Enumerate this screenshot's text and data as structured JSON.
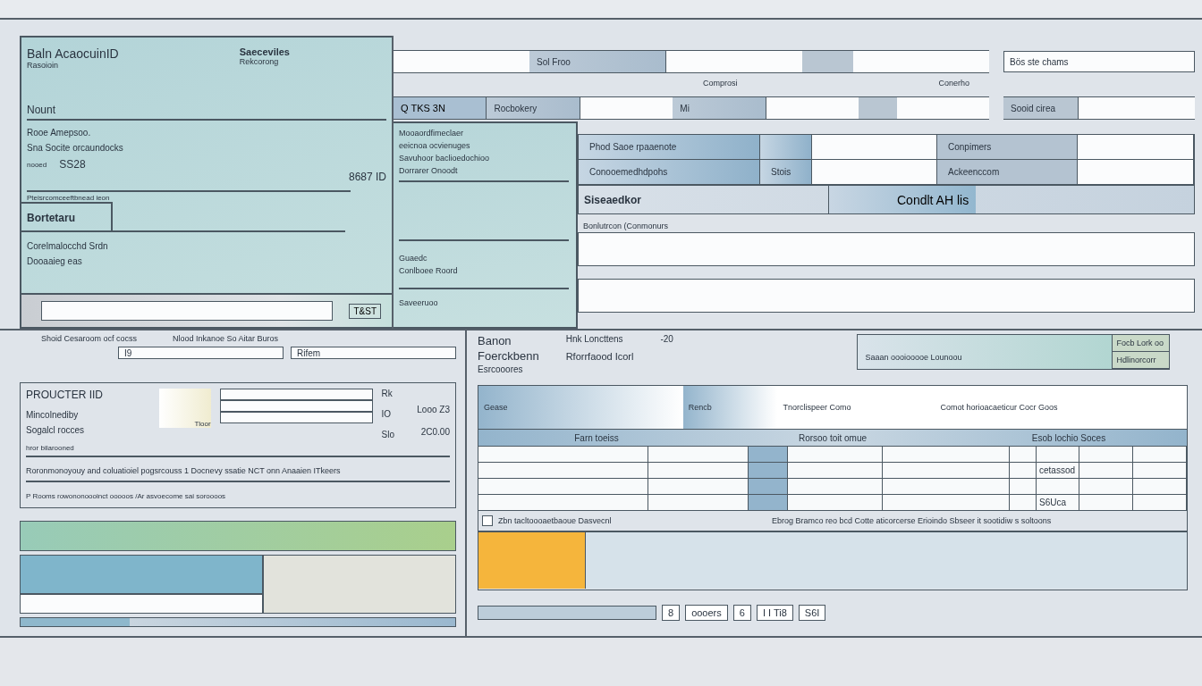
{
  "account_card": {
    "title": "Baln AcaocuinID",
    "subtitle": "Rasoioin",
    "side_title": "Saeceviles",
    "side_subtitle": "Rekcorong",
    "amount_label": "Nount",
    "lines": [
      "Rooe Amepsoo.",
      "Sna Socite orcaundocks"
    ],
    "code_label": "nooed",
    "code": "SS28",
    "id_label": "8687 ID",
    "field_caption": "Pteisrcomceeftbnead ieon",
    "tab_label": "Bortetaru",
    "notes": [
      "Corelmalocchd Srdn",
      "Dooaaieg eas"
    ],
    "footer_button": "T&ST"
  },
  "top_rows": [
    {
      "cells": [
        {
          "kind": "blank"
        },
        {
          "kind": "label",
          "text": "Sol Froo"
        },
        {
          "kind": "blank"
        },
        {
          "kind": "shade"
        },
        {
          "kind": "blank"
        }
      ],
      "side": {
        "kind": "field",
        "value": "Bös ste chams"
      },
      "captions": [
        "Comprosi",
        "Conerho"
      ]
    },
    {
      "cells": [
        {
          "kind": "tab",
          "text": "Q TKS 3N",
          "selected": true
        },
        {
          "kind": "label",
          "text": "Rocbokery"
        },
        {
          "kind": "blank"
        },
        {
          "kind": "label",
          "text": "Mi"
        },
        {
          "kind": "blank"
        },
        {
          "kind": "shade"
        },
        {
          "kind": "blank"
        }
      ],
      "side": {
        "kind": "labelled",
        "text": "Sooid cirea"
      }
    }
  ],
  "side_card": {
    "lines": [
      "Mooaordfimeclaer",
      "eeicnoa ocvienuges",
      "Savuhoor baclioedochioo",
      "Dorrarer Onoodt"
    ],
    "notes": [
      "Guaedc",
      "Conlboee Roord"
    ],
    "footer": "Saveeruoo"
  },
  "detail_grid": [
    [
      {
        "kind": "head",
        "text": "Phod Saoe rpaaenote"
      },
      {
        "kind": "head"
      },
      {
        "kind": "blank"
      },
      {
        "kind": "label",
        "text": "Conpimers"
      },
      {
        "kind": "blank"
      }
    ],
    [
      {
        "kind": "head",
        "text": "Conooemedhdpohs"
      },
      {
        "kind": "head",
        "text": "Stois"
      },
      {
        "kind": "blank"
      },
      {
        "kind": "label",
        "text": "Ackeenccom"
      },
      {
        "kind": "blank"
      }
    ]
  ],
  "section_bar": {
    "label": "Siseaedkor",
    "button": "Condlt AH lis"
  },
  "comment": {
    "caption": "Bonlutrcon (Conmonurs"
  },
  "product_panel": {
    "header": [
      "Shoid Cesaroom ocf cocss",
      "Nlood Inkanoe So Aitar Buros"
    ],
    "sub_fields": [
      "I9",
      "Rifem"
    ],
    "title": "PROUCTER IID",
    "labels": [
      "Mincolnediby",
      "Sogalcl rocces"
    ],
    "hint": "hror bilarooned",
    "field_tag": "Tloor",
    "right": [
      "Rk",
      "IO",
      "Slo"
    ],
    "amounts": [
      "Looo Z3",
      "2C0.00"
    ],
    "sentences": [
      "Roronmonoyouy and coluatioiel pogsrcouss 1 Docnevy ssatie NCT onn Anaaien ITkeers",
      "P Rooms rowononoooinct ooooos /Ar asvoecome sai soroooos"
    ]
  },
  "order_panel": {
    "labels": [
      "Banon",
      "Foerckbenn",
      "Esrcooores"
    ],
    "mid": [
      "Hnk Loncttens",
      "Rforrfaood Icorl"
    ],
    "value": "-20",
    "summary": {
      "text": "Saaan oooiooooe Lounoou",
      "tags": [
        "Focb Lork oo",
        "Hdlinorcorr"
      ]
    }
  },
  "table": {
    "top": [
      "Gease",
      "Rencb",
      "Tnorclispeer Como",
      "Comot horioacaeticur Cocr Goos"
    ],
    "columns": [
      "Farn toeiss",
      "Rorsoo toit omue",
      "Esob lochio Soces"
    ],
    "rows": [
      {
        "kind": "plain"
      },
      {
        "kind": "noted",
        "note": "cetassod"
      },
      {
        "kind": "plain"
      },
      {
        "kind": "noted",
        "note": "S6Uca"
      }
    ],
    "footer": {
      "check_label": "Zbn tacltoooaetbaoue Dasvecnl",
      "checked": false,
      "note": "Ebrog Bramco reo bcd Cotte aticorcerse Erioindo Sbseer it sootidiw s soltoons"
    }
  },
  "pager": [
    "8",
    "oooers",
    "6",
    "I I Ti8",
    "S6I"
  ]
}
